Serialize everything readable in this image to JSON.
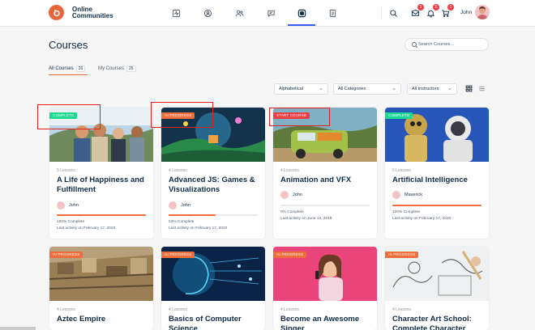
{
  "header": {
    "brand_line1": "Online",
    "brand_line2": "Communities",
    "nav_icons": [
      "activity-icon",
      "profile-icon",
      "members-icon",
      "forums-icon",
      "courses-icon",
      "documents-icon"
    ],
    "user_name": "John",
    "badges": {
      "messages": "1",
      "notifications": "6",
      "cart": "1"
    }
  },
  "page": {
    "title": "Courses",
    "search_placeholder": "Search Courses...",
    "tabs": [
      {
        "label": "All Courses",
        "count": "26"
      },
      {
        "label": "My Courses",
        "count": "26"
      }
    ],
    "filters": {
      "order": "Alphabetical",
      "category": "All Categories",
      "instructor": "All Instructors"
    }
  },
  "courses": [
    {
      "status": "Complete",
      "lessons": "5 Lessons",
      "title": "A Life of Happiness and Fulfillment",
      "author": "John",
      "progress_label": "100% Complete",
      "progress": 100,
      "last": "Last activity on February 17, 2020"
    },
    {
      "status": "In Progress",
      "lessons": "4 Lessons",
      "title": "Advanced JS: Games & Visualizations",
      "author": "John",
      "progress_label": "53% Complete",
      "progress": 53,
      "last": "Last activity on February 17, 2020"
    },
    {
      "status": "Start Course",
      "lessons": "4 Lessons",
      "title": "Animation and VFX",
      "author": "John",
      "progress_label": "0% Complete",
      "progress": 0,
      "last": "Last activity on June 13, 2019"
    },
    {
      "status": "Complete",
      "lessons": "6 Lessons",
      "title": "Artificial Intelligence",
      "author": "Maverick",
      "progress_label": "100% Complete",
      "progress": 100,
      "last": "Last activity on February 17, 2020"
    },
    {
      "status": "In Progress",
      "lessons": "4 Lessons",
      "title": "Aztec Empire"
    },
    {
      "status": "In Progress",
      "lessons": "4 Lessons",
      "title": "Basics of Computer Science"
    },
    {
      "status": "In Progress",
      "lessons": "4 Lessons",
      "title": "Become an Awesome Singer"
    },
    {
      "status": "In Progress",
      "lessons": "4 Lessons",
      "title": "Character Art School: Complete Character"
    }
  ],
  "colors": {
    "accent": "#e8643b",
    "complete": "#1cd991",
    "in_progress": "#ef6c3b",
    "start": "#ef3e46",
    "annotation": "#e0201f"
  }
}
